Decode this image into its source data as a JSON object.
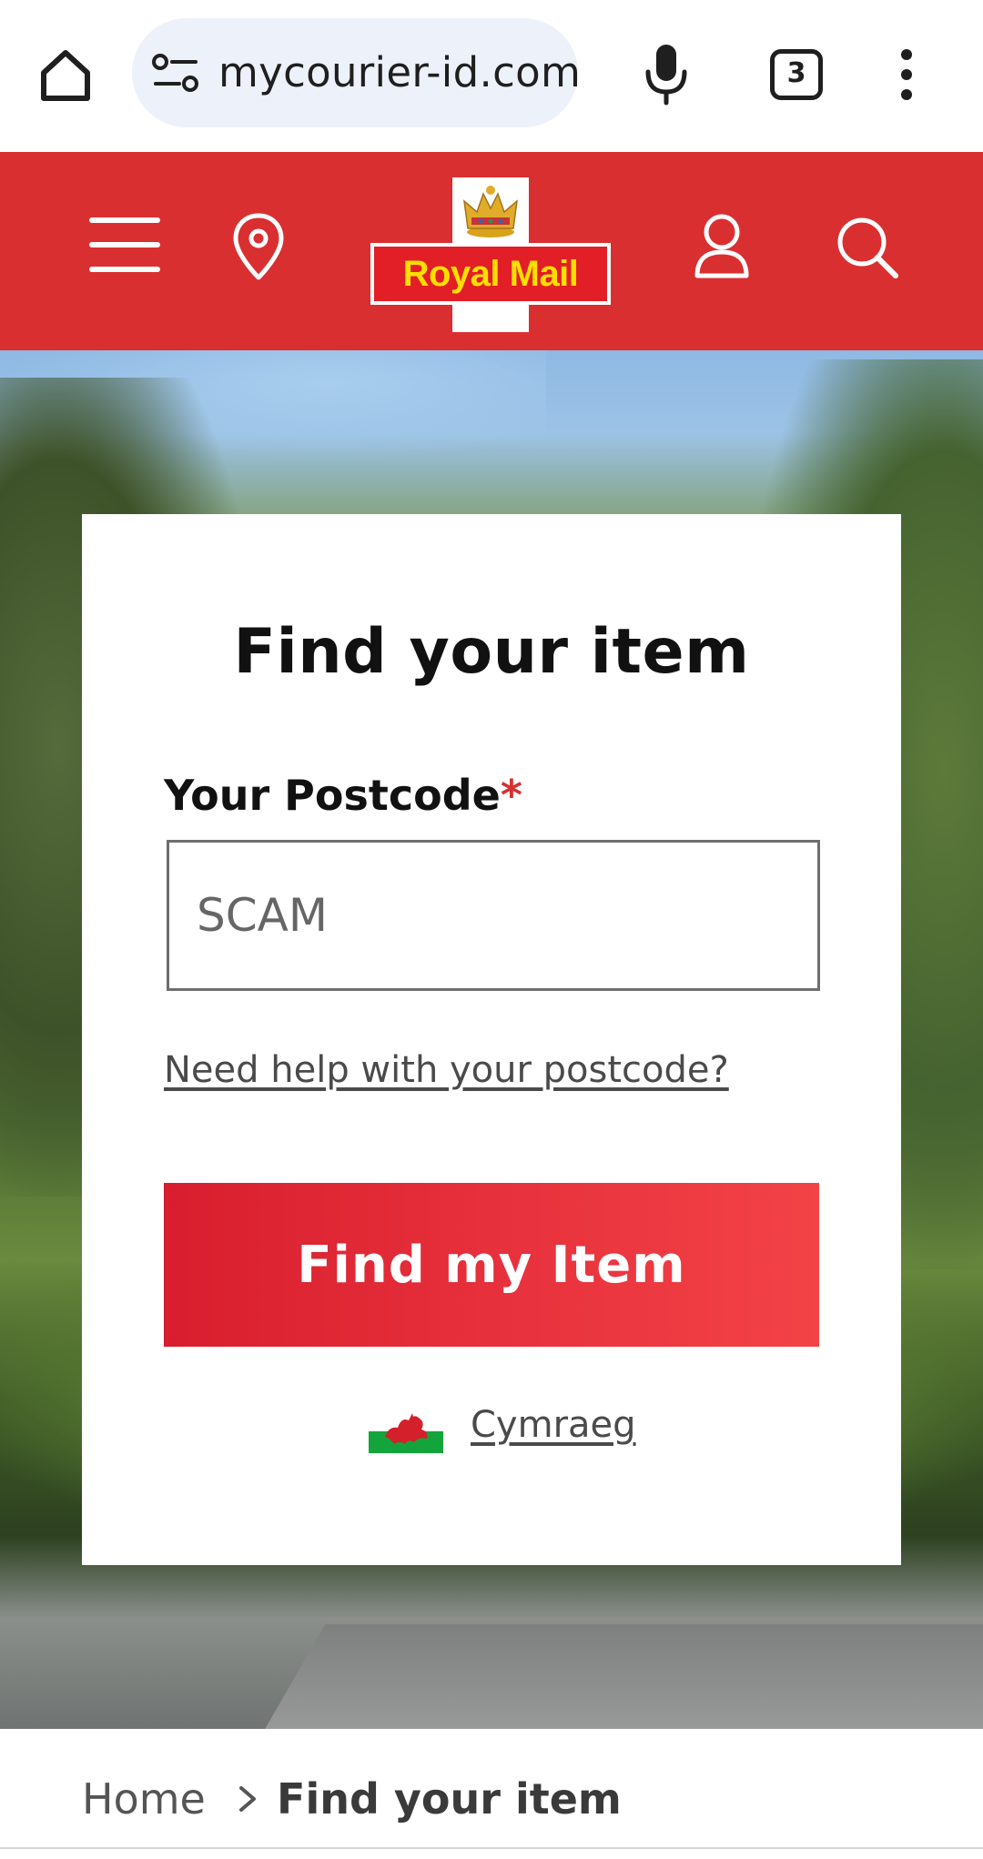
{
  "browser": {
    "url": "mycourier-id.com",
    "tab_count": "3",
    "icons": [
      "home-icon",
      "site-settings-icon",
      "microphone-icon",
      "tab-switcher-icon",
      "more-vert-icon"
    ]
  },
  "header": {
    "logo_text": "Royal Mail",
    "background_color": "#da2f31",
    "logo_text_color": "#ffde00",
    "icons": [
      "menu-icon",
      "location-pin-icon",
      "account-icon",
      "search-icon"
    ]
  },
  "card": {
    "title": "Find your item",
    "postcode_label": "Your Postcode",
    "required_marker": "*",
    "postcode_value": "SCAM",
    "help_link": "Need help with your postcode?",
    "button_label": "Find my Item",
    "language_link": "Cymraeg",
    "button_color": "#e4293a"
  },
  "breadcrumb": {
    "home": "Home",
    "current": "Find your item"
  }
}
